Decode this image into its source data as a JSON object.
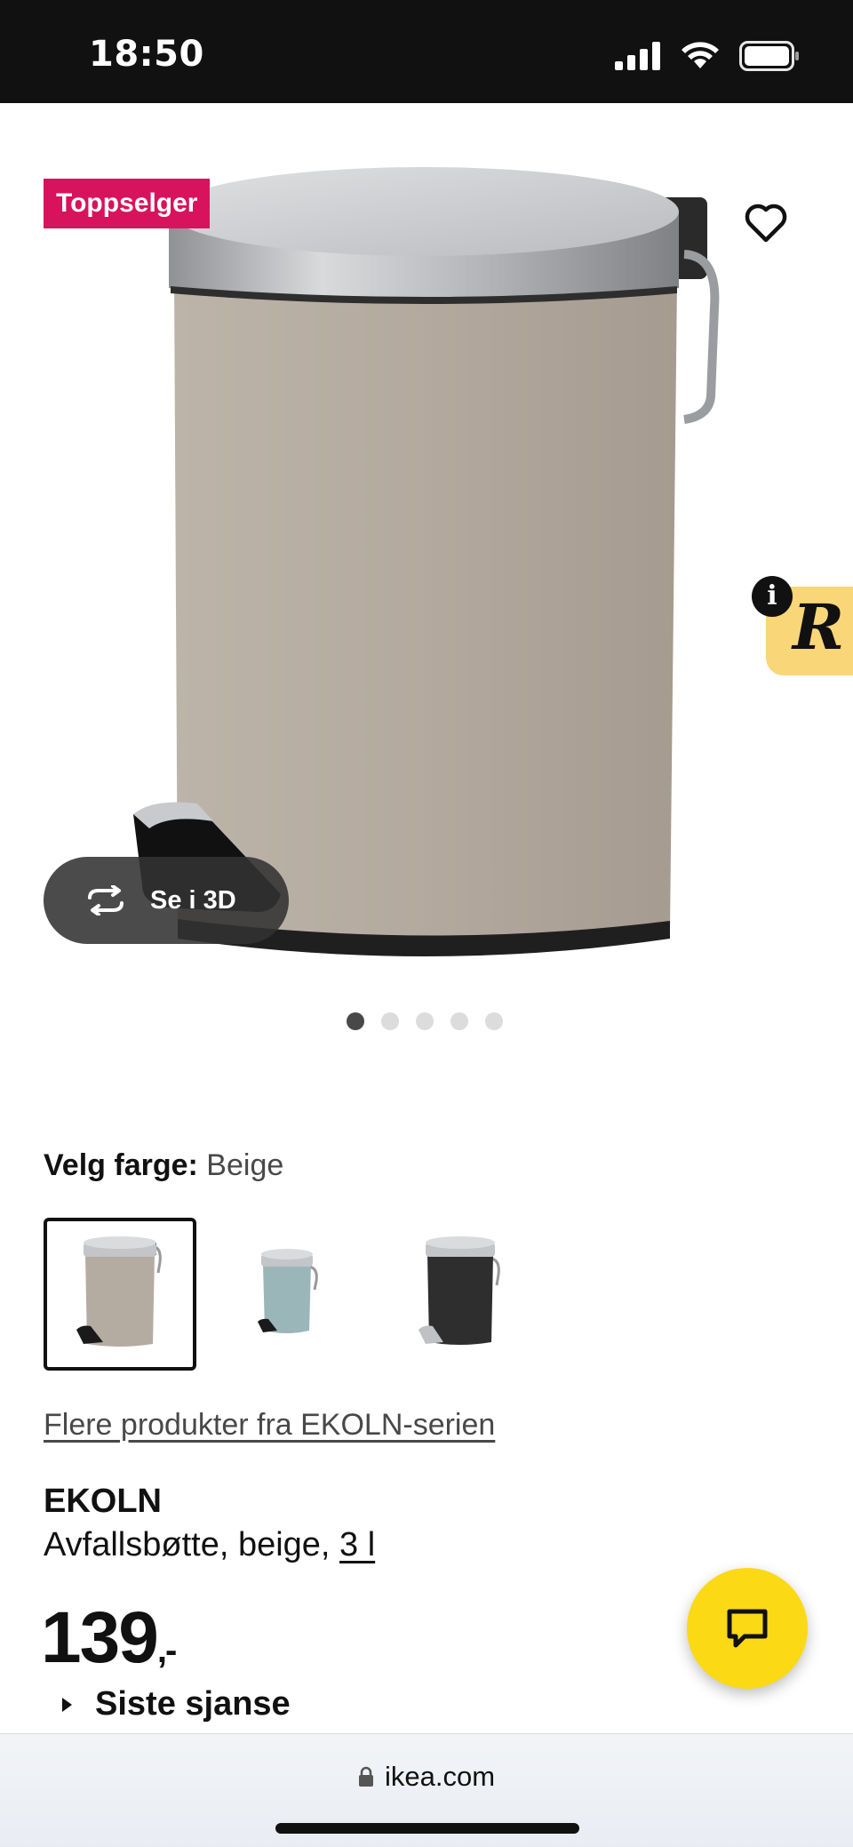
{
  "status_bar": {
    "time": "18:50"
  },
  "hero": {
    "badge": "Toppselger",
    "view_3d_label": "Se i 3D",
    "image_count": 5,
    "active_image": 1,
    "widget_info": "i"
  },
  "color_select": {
    "label": "Velg farge:",
    "value": "Beige",
    "options": [
      {
        "name": "Beige",
        "body_color": "#b5aca1",
        "selected": true
      },
      {
        "name": "Turquoise",
        "body_color": "#9bb6b8",
        "selected": false
      },
      {
        "name": "Black",
        "body_color": "#2e2e2e",
        "selected": false
      }
    ]
  },
  "series_link": "Flere produkter fra EKOLN-serien",
  "product": {
    "name": "EKOLN",
    "description": "Avfallsbøtte, beige, ",
    "size": "3 l",
    "price": "139",
    "price_suffix": ",-",
    "promo": "Siste sjanse"
  },
  "browser": {
    "url": "ikea.com"
  },
  "colors": {
    "badge": "#d8135d",
    "chat_button": "#fbd914",
    "widget": "#f9d677"
  }
}
